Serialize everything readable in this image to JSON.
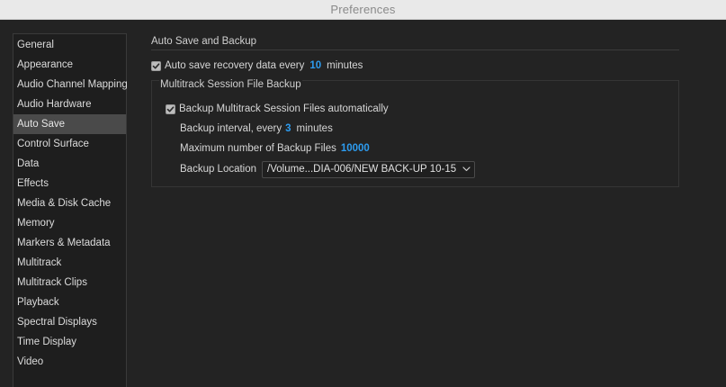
{
  "window": {
    "title": "Preferences"
  },
  "sidebar": {
    "active_index": 4,
    "items": [
      {
        "label": "General"
      },
      {
        "label": "Appearance"
      },
      {
        "label": "Audio Channel Mapping"
      },
      {
        "label": "Audio Hardware"
      },
      {
        "label": "Auto Save"
      },
      {
        "label": "Control Surface"
      },
      {
        "label": "Data"
      },
      {
        "label": "Effects"
      },
      {
        "label": "Media & Disk Cache"
      },
      {
        "label": "Memory"
      },
      {
        "label": "Markers & Metadata"
      },
      {
        "label": "Multitrack"
      },
      {
        "label": "Multitrack Clips"
      },
      {
        "label": "Playback"
      },
      {
        "label": "Spectral Displays"
      },
      {
        "label": "Time Display"
      },
      {
        "label": "Video"
      }
    ]
  },
  "auto_save": {
    "section_title": "Auto Save and Backup",
    "recovery": {
      "checked": true,
      "label_before": "Auto save recovery data every",
      "value": "10",
      "label_after": "minutes"
    },
    "multitrack_backup": {
      "group_title": "Multitrack Session File Backup",
      "enable": {
        "checked": true,
        "label": "Backup Multitrack Session Files automatically"
      },
      "interval": {
        "label_before": "Backup interval, every",
        "value": "3",
        "label_after": "minutes"
      },
      "max_files": {
        "label": "Maximum number of Backup Files",
        "value": "10000"
      },
      "location": {
        "label": "Backup Location",
        "selected": "/Volume...DIA-006/NEW BACK-UP 10-15"
      }
    }
  },
  "colors": {
    "accent_value": "#2d9cf0",
    "background": "#232323",
    "sidebar_selected": "#4a4a4a"
  },
  "icons": {
    "checkbox": "checkmark-icon",
    "dropdown": "chevron-down-icon"
  }
}
